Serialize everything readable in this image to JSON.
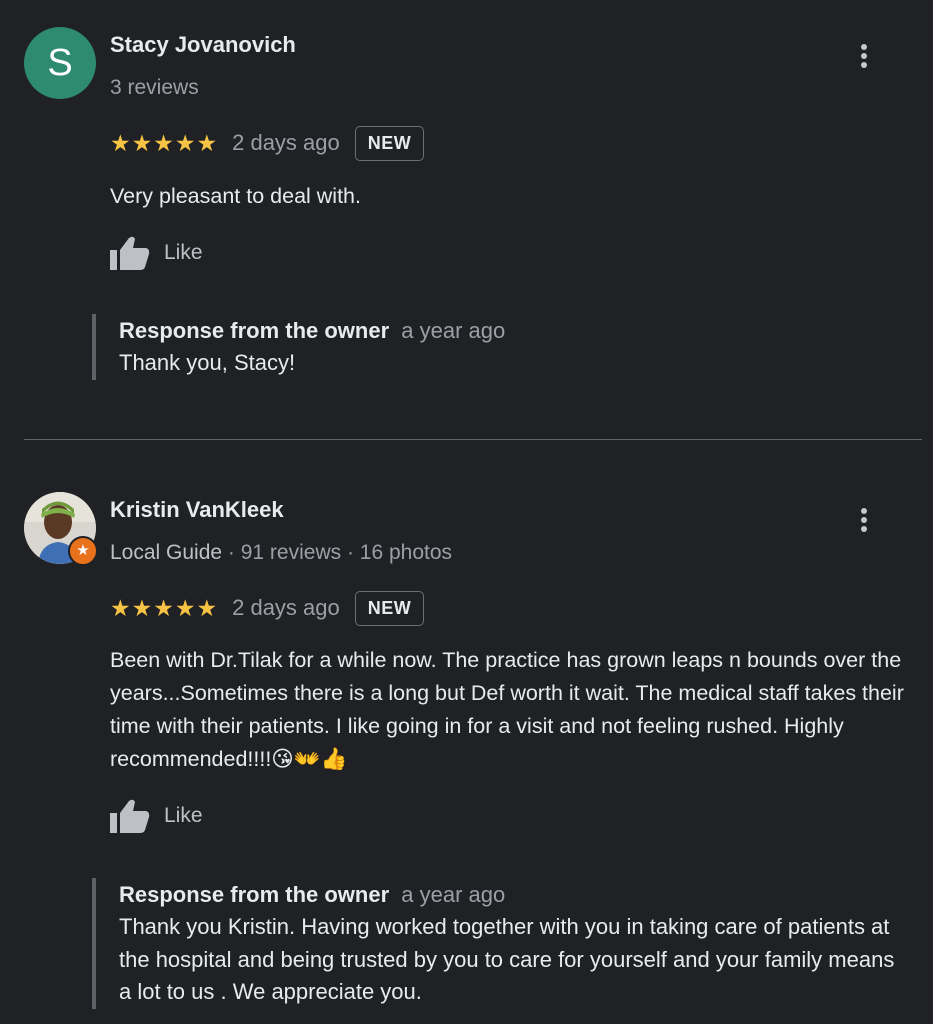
{
  "reviews": [
    {
      "avatar_letter": "S",
      "name": "Stacy Jovanovich",
      "meta": "3 reviews",
      "stars": "★★★★★",
      "rating": 5,
      "time": "2 days ago",
      "badge": "NEW",
      "text": "Very pleasant to deal with.",
      "like_label": "Like",
      "owner_label": "Response from the owner",
      "owner_time": "a year ago",
      "owner_text": "Thank you, Stacy!"
    },
    {
      "name": "Kristin VanKleek",
      "meta_guide": "Local Guide",
      "meta_rest": " · 91 reviews · 16 photos",
      "stars": "★★★★★",
      "rating": 5,
      "time": "2 days ago",
      "badge": "NEW",
      "text": "Been with Dr.Tilak for a while now.  The practice has grown leaps n bounds over the years...Sometimes there is a long but Def worth it wait. The medical staff takes their time with their patients. I like going in for a visit and not feeling rushed. Highly recommended!!!!😘👐👍",
      "like_label": "Like",
      "owner_label": "Response from the owner",
      "owner_time": "a year ago",
      "owner_text": "Thank you Kristin. Having worked together with you in taking care of patients at the hospital and being trusted by you to care for yourself and your family means a lot to us . We appreciate you."
    }
  ],
  "colors": {
    "background": "#202124",
    "star": "#f6c344",
    "avatar_s": "#2e8b6f",
    "local_guide_badge": "#e8711c"
  },
  "icons": [
    "more-vert-icon",
    "thumbs-up-icon",
    "local-guide-star-icon"
  ]
}
